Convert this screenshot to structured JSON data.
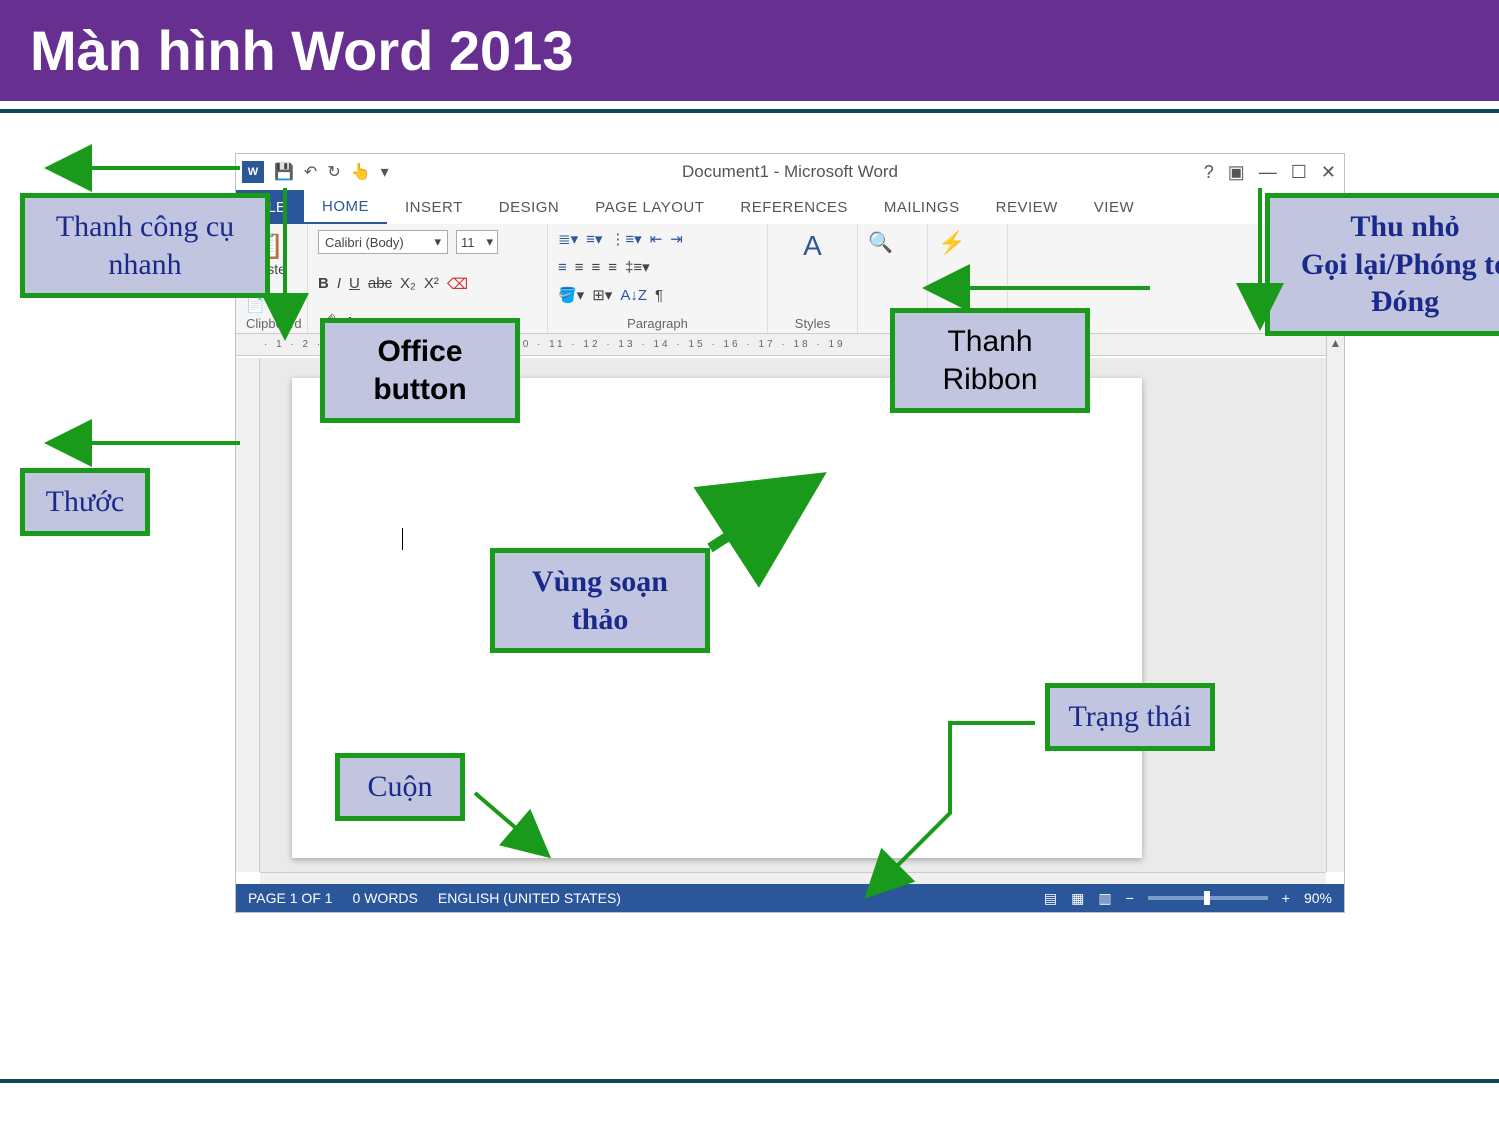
{
  "slide": {
    "title": "Màn hình Word 2013"
  },
  "word": {
    "title": "Document1 - Microsoft Word",
    "qat_icons": [
      "word",
      "save",
      "undo",
      "redo",
      "touch",
      "customize"
    ],
    "window_icons": [
      "help",
      "ribbon-options",
      "minimize",
      "maximize",
      "close"
    ],
    "file_tab": "FILE",
    "tabs": [
      "HOME",
      "INSERT",
      "DESIGN",
      "PAGE LAYOUT",
      "REFERENCES",
      "MAILINGS",
      "REVIEW",
      "VIEW"
    ],
    "active_tab": "HOME",
    "font_name": "Calibri (Body)",
    "font_size": "11",
    "groups": {
      "clipboard": "Clipboard",
      "paragraph": "Paragraph",
      "styles": "Styles"
    },
    "paste_label": "Paste",
    "status": {
      "page": "PAGE 1 OF 1",
      "words": "0 WORDS",
      "language": "ENGLISH (UNITED STATES)",
      "zoom": "90%"
    },
    "ruler_max": 19
  },
  "callouts": {
    "qat": "Thanh công cụ nhanh",
    "office_button": "Office button",
    "ribbon": "Thanh Ribbon",
    "window_controls": "Thu nhỏ\nGọi lại/Phóng to\nĐóng",
    "ruler": "Thước",
    "editing_area": "Vùng soạn thảo",
    "scroll": "Cuộn",
    "status": "Trạng thái"
  }
}
